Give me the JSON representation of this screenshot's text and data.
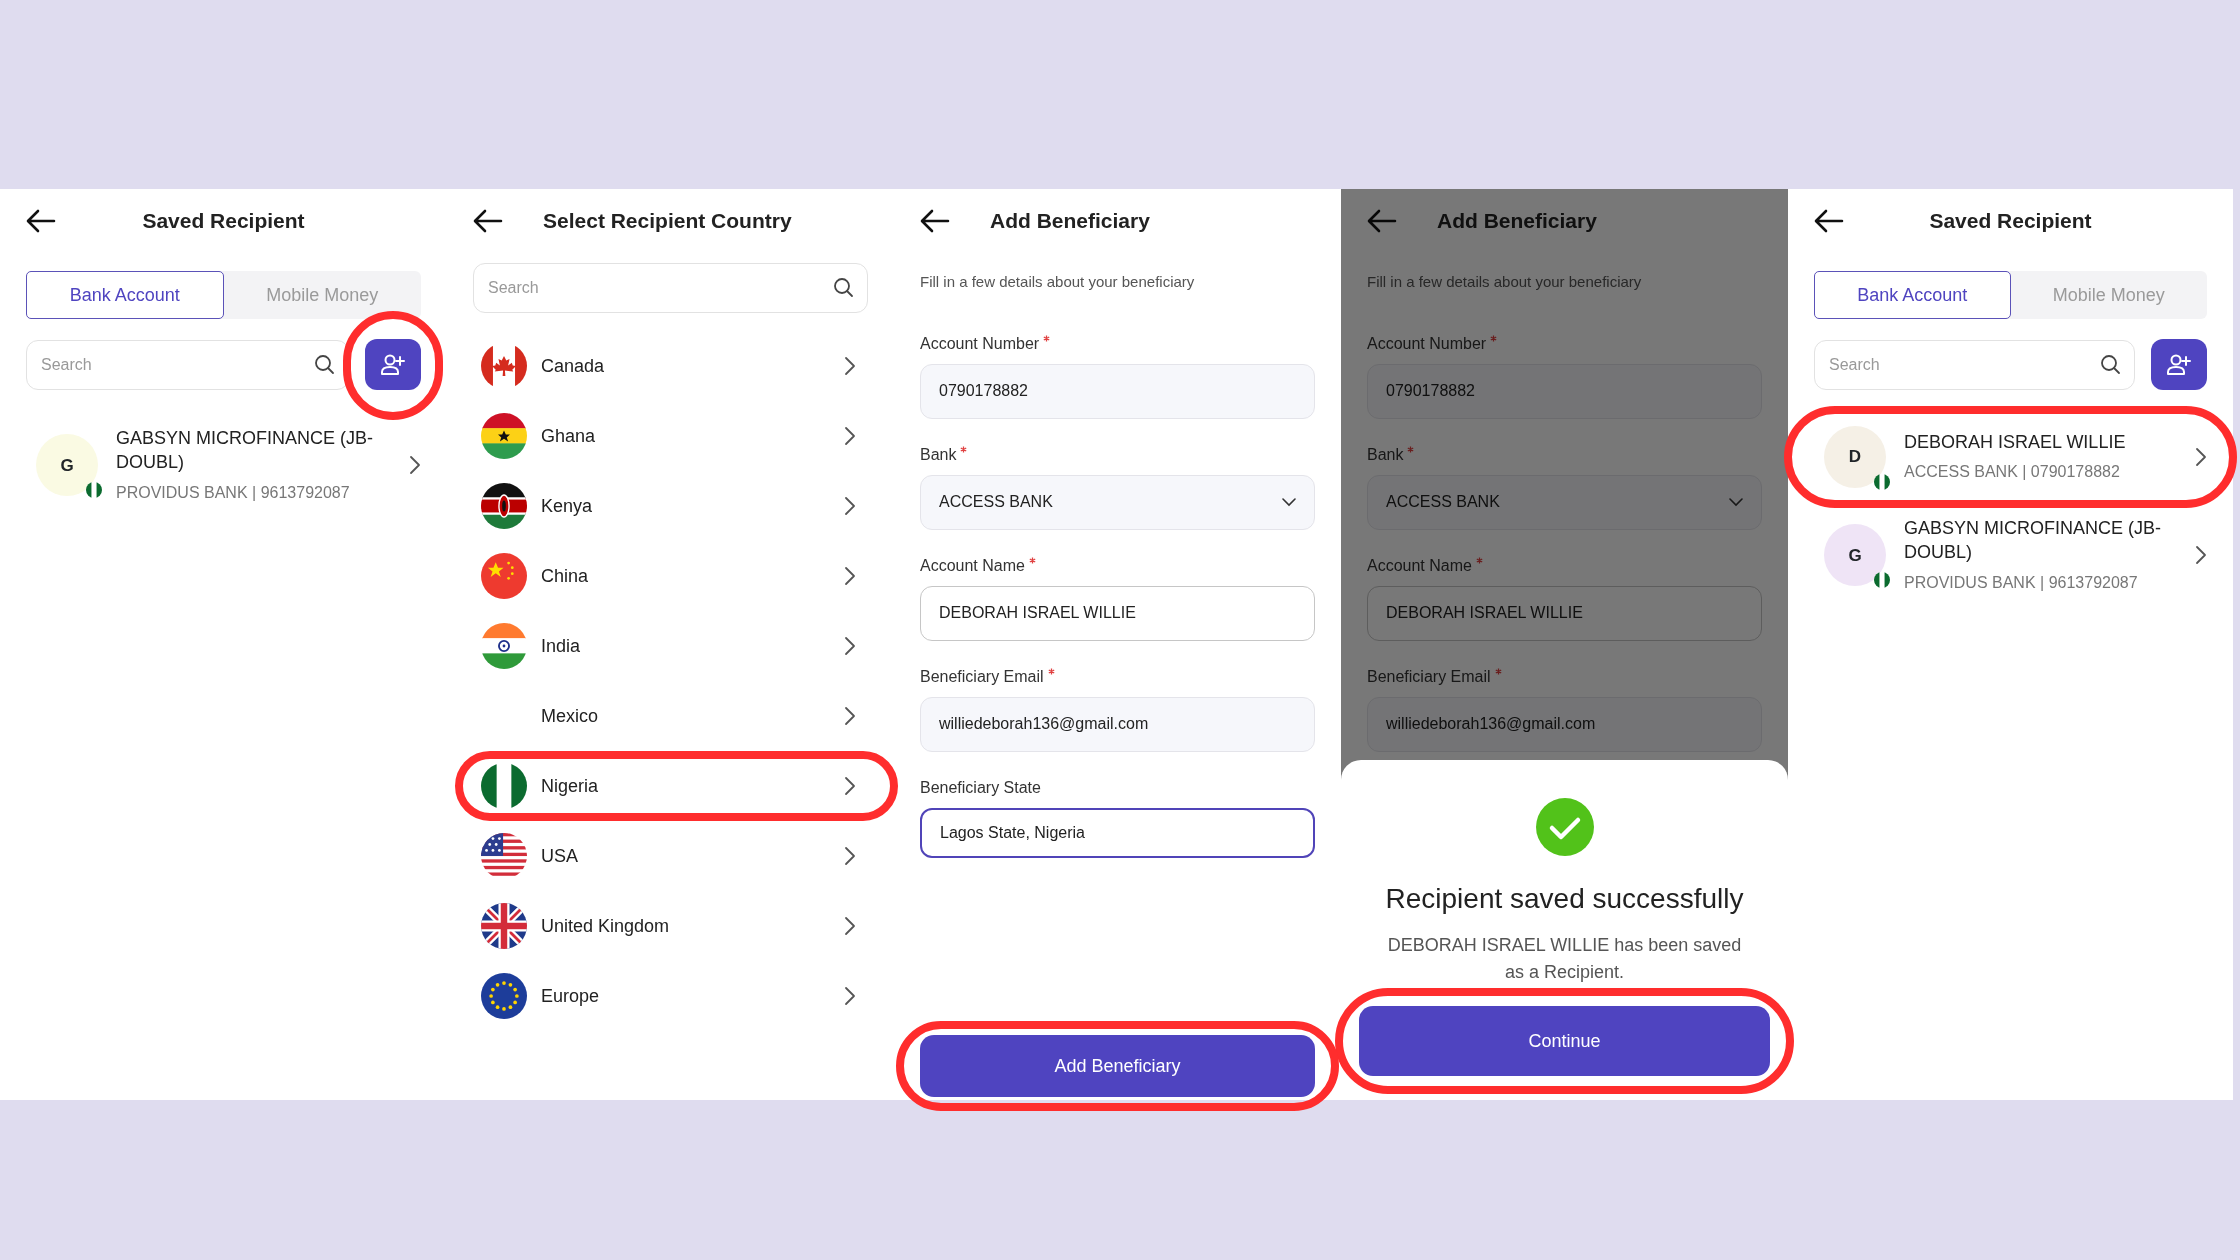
{
  "screens": [
    {
      "kind": "recipients",
      "title": "Saved Recipient",
      "tabs": [
        {
          "label": "Bank Account",
          "selected": true
        },
        {
          "label": "Mobile Money",
          "selected": false
        }
      ],
      "search": {
        "placeholder": "Search"
      },
      "add_button": {
        "highlighted": true
      },
      "recipients": [
        {
          "initial": "G",
          "name": "GABSYN MICROFINANCE (JB-DOUBL)",
          "detail": "PROVIDUS BANK | 9613792087",
          "color": "#fafae3",
          "highlighted": false
        }
      ]
    },
    {
      "kind": "countries",
      "title": "Select Recipient Country",
      "search": {
        "placeholder": "Search"
      },
      "countries": [
        {
          "name": "Canada",
          "highlighted": false
        },
        {
          "name": "Ghana",
          "highlighted": false
        },
        {
          "name": "Kenya",
          "highlighted": false
        },
        {
          "name": "China",
          "highlighted": false
        },
        {
          "name": "India",
          "highlighted": false
        },
        {
          "name": "Mexico",
          "highlighted": false
        },
        {
          "name": "Nigeria",
          "highlighted": true
        },
        {
          "name": "USA",
          "highlighted": false
        },
        {
          "name": "United Kingdom",
          "highlighted": false
        },
        {
          "name": "Europe",
          "highlighted": false
        }
      ]
    },
    {
      "kind": "form",
      "title": "Add Beneficiary",
      "subtitle": "Fill in a few details about your beneficiary",
      "fields": [
        {
          "kind": "filled",
          "label": "Account Number",
          "required": true,
          "value": "0790178882",
          "focused": false
        },
        {
          "kind": "select",
          "label": "Bank",
          "required": true,
          "value": "ACCESS BANK",
          "focused": false
        },
        {
          "kind": "outlined",
          "label": "Account Name",
          "required": true,
          "value": "DEBORAH ISRAEL WILLIE",
          "focused": false
        },
        {
          "kind": "filled",
          "label": "Beneficiary Email",
          "required": true,
          "value": "williedeborah136@gmail.com",
          "focused": false
        },
        {
          "kind": "outlined",
          "label": "Beneficiary State",
          "required": false,
          "value": "Lagos State, Nigeria",
          "focused": true
        }
      ],
      "button": {
        "label": "Add Beneficiary",
        "highlighted": true
      }
    },
    {
      "kind": "form",
      "title": "Add Beneficiary",
      "subtitle": "Fill in a few details about your beneficiary",
      "fields": [
        {
          "kind": "filled",
          "label": "Account Number",
          "required": true,
          "value": "0790178882",
          "focused": false
        },
        {
          "kind": "select",
          "label": "Bank",
          "required": true,
          "value": "ACCESS BANK",
          "focused": false
        },
        {
          "kind": "outlined",
          "label": "Account Name",
          "required": true,
          "value": "DEBORAH ISRAEL WILLIE",
          "focused": false
        },
        {
          "kind": "filled",
          "label": "Beneficiary Email",
          "required": true,
          "value": "williedeborah136@gmail.com",
          "focused": false
        }
      ],
      "dialog": {
        "title": "Recipient saved successfully",
        "message": "DEBORAH ISRAEL WILLIE has been saved as a Recipient.",
        "button": {
          "label": "Continue",
          "highlighted": true
        }
      }
    },
    {
      "kind": "recipients",
      "title": "Saved Recipient",
      "tabs": [
        {
          "label": "Bank Account",
          "selected": true
        },
        {
          "label": "Mobile Money",
          "selected": false
        }
      ],
      "search": {
        "placeholder": "Search"
      },
      "recipients": [
        {
          "initial": "D",
          "name": "DEBORAH ISRAEL WILLIE",
          "detail": "ACCESS BANK | 0790178882",
          "color": "#f5f0e6",
          "highlighted": true
        },
        {
          "initial": "G",
          "name": "GABSYN MICROFINANCE (JB-DOUBL)",
          "detail": "PROVIDUS BANK | 9613792087",
          "color": "#efe4f6",
          "highlighted": false
        }
      ]
    }
  ]
}
